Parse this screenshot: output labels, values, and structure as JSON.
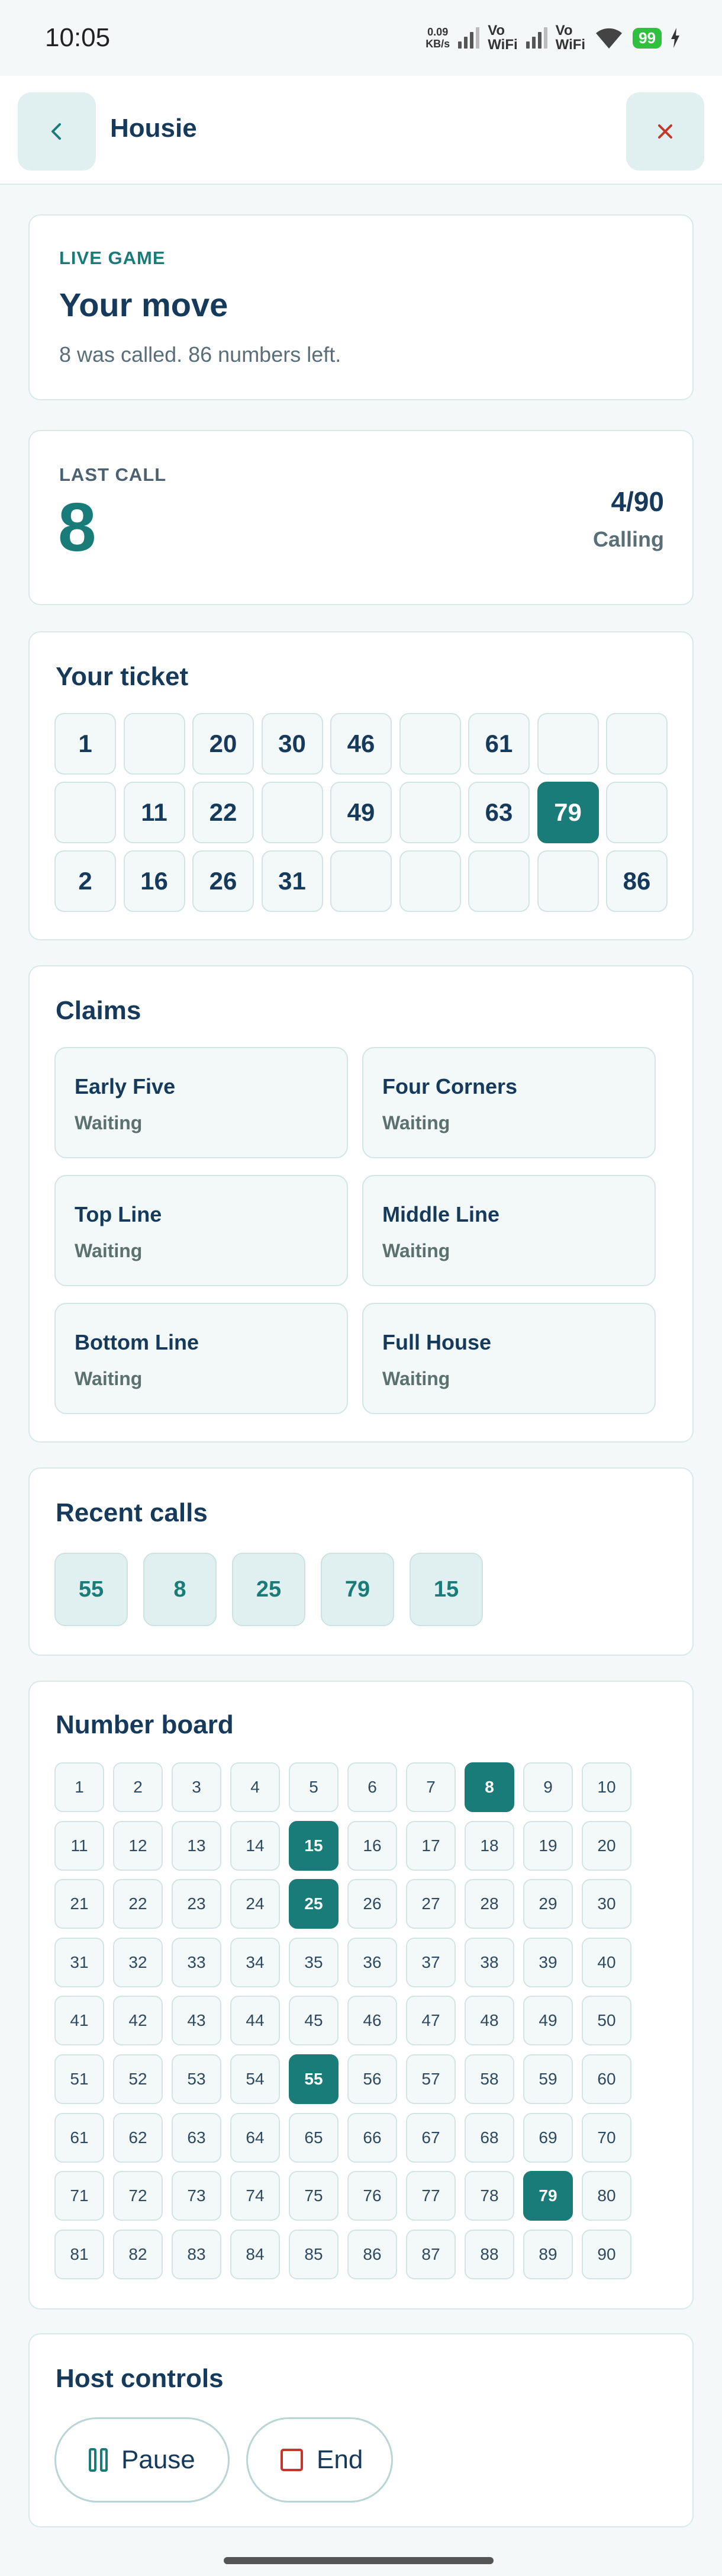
{
  "status_bar": {
    "time": "10:05",
    "net_speed_value": "0.09",
    "net_speed_unit": "KB/s",
    "vowifi_1_top": "Vo",
    "vowifi_1_bottom": "WiFi",
    "vowifi_2_top": "Vo",
    "vowifi_2_bottom": "WiFi",
    "battery": "99",
    "battery_color": "#2fc13e"
  },
  "header": {
    "title": "Housie",
    "back_icon": "chevron-left-icon",
    "close_icon": "close-icon",
    "close_color": "#c0392b"
  },
  "live": {
    "eyebrow": "LIVE GAME",
    "heading": "Your move",
    "subtitle": "8 was called. 86 numbers left."
  },
  "last_call": {
    "eyebrow": "LAST CALL",
    "number": "8",
    "progress": "4/90",
    "state": "Calling"
  },
  "ticket": {
    "title": "Your ticket",
    "rows": [
      [
        "1",
        "",
        "20",
        "30",
        "46",
        "",
        "61",
        "",
        ""
      ],
      [
        "",
        "11",
        "22",
        "",
        "49",
        "",
        "63",
        "79",
        ""
      ],
      [
        "2",
        "16",
        "26",
        "31",
        "",
        "",
        "",
        "",
        "86"
      ]
    ],
    "marked": [
      "79"
    ]
  },
  "claims": {
    "title": "Claims",
    "items": [
      {
        "name": "Early Five",
        "status": "Waiting"
      },
      {
        "name": "Four Corners",
        "status": "Waiting"
      },
      {
        "name": "Top Line",
        "status": "Waiting"
      },
      {
        "name": "Middle Line",
        "status": "Waiting"
      },
      {
        "name": "Bottom Line",
        "status": "Waiting"
      },
      {
        "name": "Full House",
        "status": "Waiting"
      }
    ]
  },
  "recent_calls": {
    "title": "Recent calls",
    "items": [
      "55",
      "8",
      "25",
      "79",
      "15"
    ]
  },
  "board": {
    "title": "Number board",
    "total": 90,
    "called": [
      "8",
      "15",
      "25",
      "55",
      "79"
    ]
  },
  "host_controls": {
    "title": "Host controls",
    "pause_label": "Pause",
    "pause_icon": "pause-icon",
    "end_label": "End",
    "end_icon": "stop-icon",
    "accent_color": "#1a7c78",
    "end_icon_color": "#c0392b"
  },
  "theme": {
    "accent": "#1a7c78",
    "text": "#153a5c"
  }
}
